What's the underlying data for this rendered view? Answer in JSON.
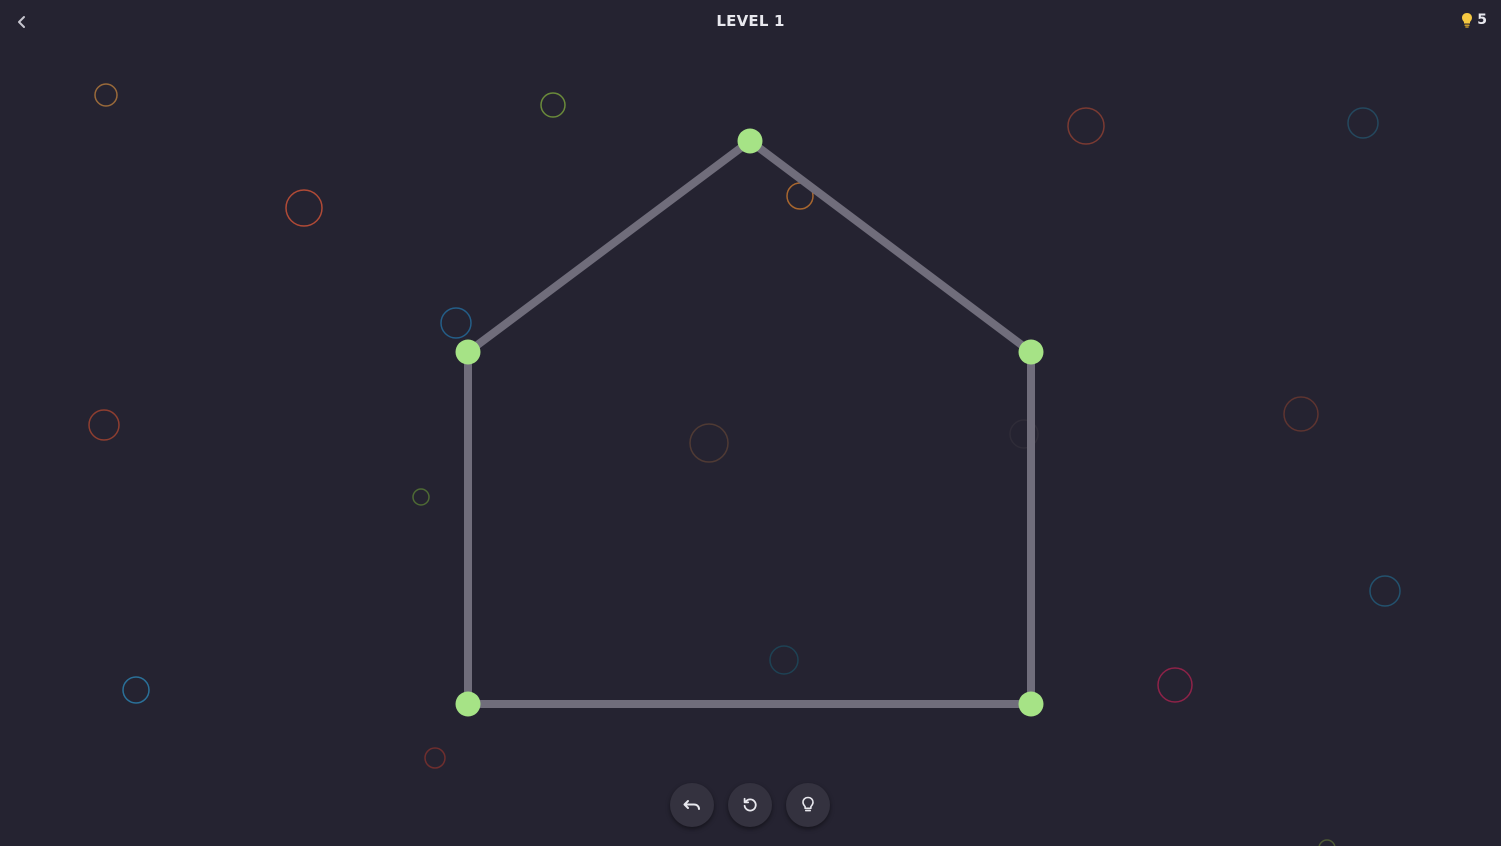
{
  "header": {
    "title": "LEVEL 1",
    "hint_count": "5"
  },
  "colors": {
    "background": "#252331",
    "node": "#a6e386",
    "edge": "#706d7b",
    "text": "#e8e8ee",
    "button": "#34323f",
    "hint_bulb": "#f5c842"
  },
  "icons": {
    "back": "chevron-left-icon",
    "hint_badge": "lightbulb-icon",
    "undo": "undo-icon",
    "restart": "restart-icon",
    "hint": "lightbulb-outline-icon"
  },
  "puzzle": {
    "shape": "house",
    "node_count": 5,
    "edge_count": 5
  },
  "controls": {
    "buttons": [
      "undo",
      "restart",
      "hint"
    ]
  }
}
